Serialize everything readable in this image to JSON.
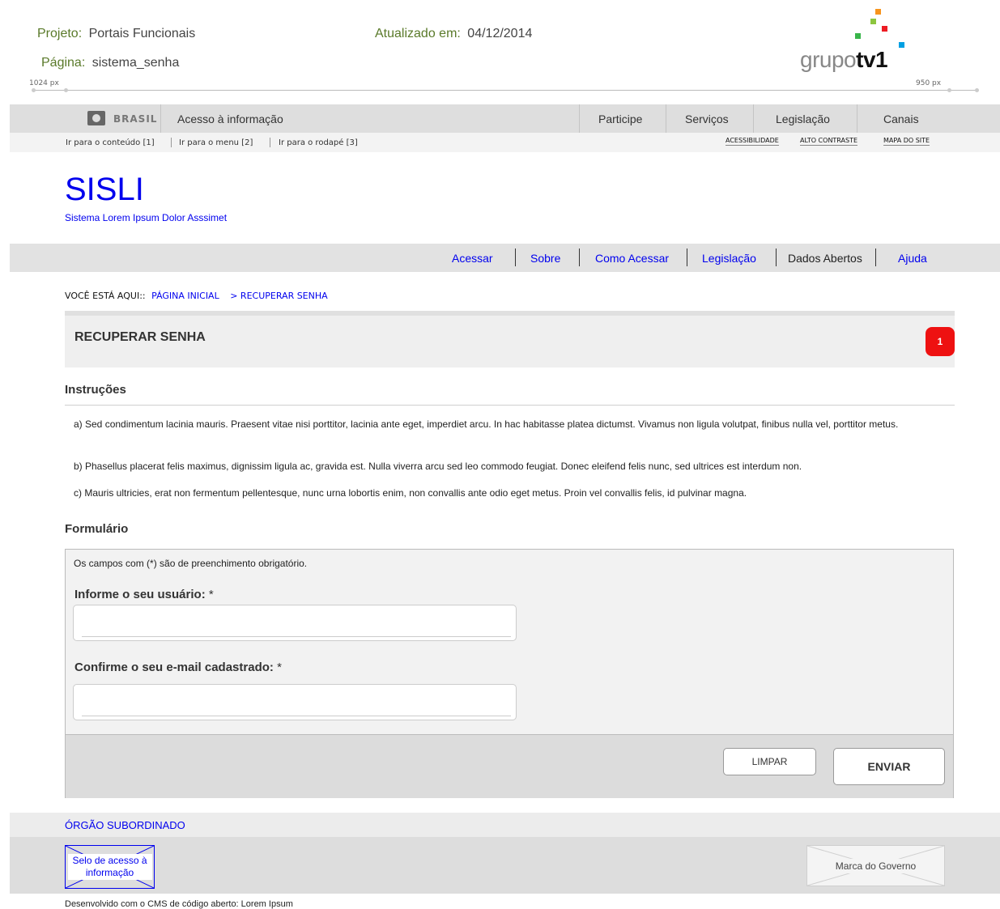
{
  "annotation": {
    "project_label": "Projeto:",
    "project_value": "Portais Funcionais",
    "page_label": "Página:",
    "page_value": "sistema_senha",
    "updated_label": "Atualizado em:",
    "updated_value": "04/12/2014",
    "ruler_left": "1024 px",
    "ruler_right": "950 px",
    "logo": {
      "text_light": "grupo",
      "text_bold": "tv1"
    }
  },
  "gov_bar": {
    "brand": "BRASIL",
    "access_info": "Acesso à informação",
    "links": [
      "Participe",
      "Serviços",
      "Legislação",
      "Canais"
    ]
  },
  "access_bar": {
    "skip_links": [
      "Ir para o conteúdo [1]",
      "Ir para o menu [2]",
      "Ir para o rodapé [3]"
    ],
    "right_links": [
      "ACESSIBILIDADE",
      "ALTO CONTRASTE",
      "MAPA DO SITE"
    ]
  },
  "site": {
    "title": "SISLI",
    "subtitle": "Sistema Lorem Ipsum Dolor Asssimet"
  },
  "nav": [
    "Acessar",
    "Sobre",
    "Como Acessar",
    "Legislação",
    "Dados Abertos",
    "Ajuda"
  ],
  "breadcrumb": {
    "prefix": "VOCÊ ESTÁ AQUI::",
    "home": "PÁGINA INICIAL",
    "current": "> RECUPERAR SENHA"
  },
  "page_title": "RECUPERAR SENHA",
  "badge": "1",
  "instructions": {
    "heading": "Instruções",
    "items": [
      "a) Sed condimentum lacinia mauris. Praesent vitae nisi porttitor, lacinia ante eget, imperdiet arcu. In hac habitasse platea dictumst. Vivamus non ligula volutpat, finibus nulla vel, porttitor metus.",
      "b) Phasellus placerat felis maximus, dignissim ligula ac, gravida est. Nulla viverra arcu sed leo commodo feugiat. Donec eleifend felis nunc, sed ultrices est interdum non.",
      "c) Mauris ultricies, erat non fermentum pellentesque, nunc urna lobortis enim, non convallis ante odio eget metus. Proin vel convallis felis, id pulvinar magna."
    ]
  },
  "form": {
    "heading": "Formulário",
    "note": "Os campos com (*) são de preenchimento obrigatório.",
    "user_label": "Informe o seu usuário:",
    "email_label": "Confirme o seu e-mail cadastrado:",
    "required_mark": "*",
    "user_value": "",
    "email_value": "",
    "clear_button": "LIMPAR",
    "submit_button": "ENVIAR"
  },
  "footer": {
    "org": "ÓRGÃO SUBORDINADO",
    "seal": "Selo de acesso à informação",
    "gov_mark": "Marca do Governo",
    "credits": "Desenvolvido com o CMS de código aberto: Lorem Ipsum"
  },
  "colors": {
    "link_blue": "#0000ee",
    "badge_red": "#ee1111",
    "logo_squares": [
      "#f7941d",
      "#8dc63f",
      "#ed1c24",
      "#39b54a",
      "#00a0e3"
    ]
  }
}
